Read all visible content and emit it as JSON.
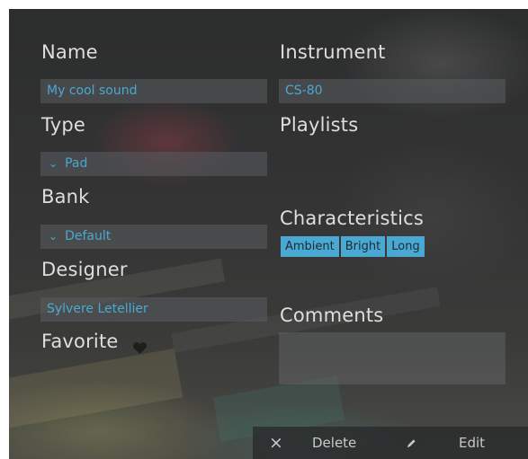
{
  "form": {
    "name_label": "Name",
    "name_value": "My cool sound",
    "type_label": "Type",
    "type_value": "Pad",
    "bank_label": "Bank",
    "bank_value": "Default",
    "designer_label": "Designer",
    "designer_value": "Sylvere Letellier",
    "favorite_label": "Favorite",
    "instrument_label": "Instrument",
    "instrument_value": "CS-80",
    "playlists_label": "Playlists",
    "characteristics_label": "Characteristics",
    "characteristics": [
      "Ambient",
      "Bright",
      "Long"
    ],
    "comments_label": "Comments",
    "comments_value": ""
  },
  "toolbar": {
    "close_glyph": "×",
    "delete_label": "Delete",
    "edit_label": "Edit"
  },
  "icons": {
    "dropdown": "chevron-down-icon",
    "favorite": "heart-icon",
    "close": "close-icon",
    "edit": "pencil-icon"
  },
  "colors": {
    "accent": "#4aa9d2",
    "label_text": "#dedede",
    "field_bg": "#5a5c60"
  }
}
